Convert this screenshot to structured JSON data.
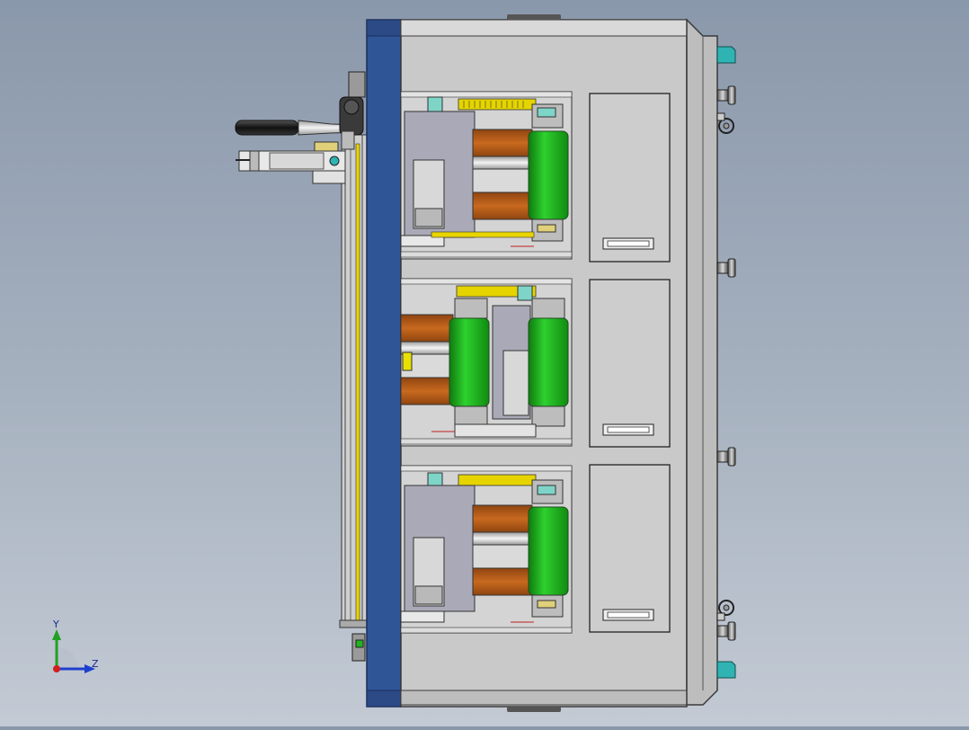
{
  "viewport": {
    "background_top": "#8a98ab",
    "background_bottom": "#c3cad4"
  },
  "model": {
    "cabinet_color": "#c8c8c8",
    "frame_color": "#2f5597",
    "roller_color": "#22b322",
    "copper_color": "#b8601a",
    "teal_color": "#2fb3b3",
    "station_count": 3,
    "access_panel_count": 3
  },
  "triad": {
    "y_label": "Y",
    "z_label": "Z",
    "y_color": "#22a022",
    "z_color": "#1d3fcf",
    "x_color": "#d02020"
  }
}
